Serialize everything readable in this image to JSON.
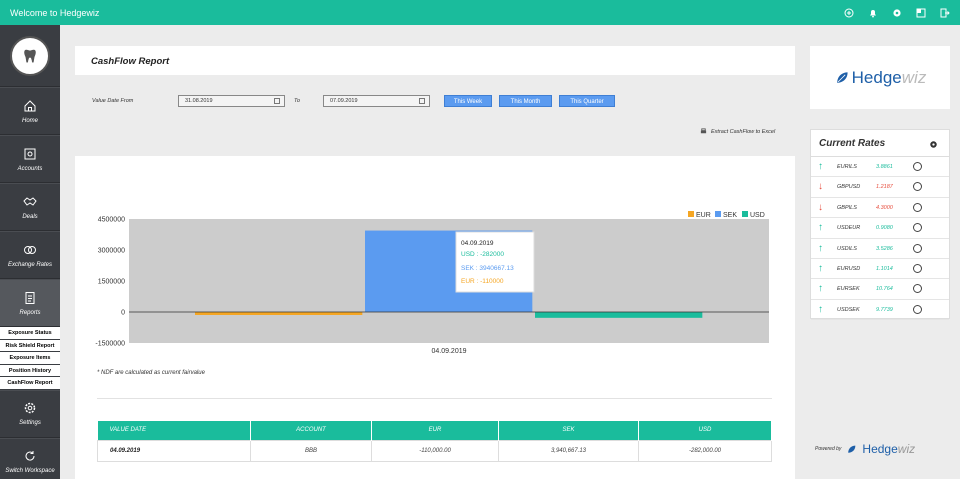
{
  "topbar": {
    "title": "Welcome to Hedgewiz"
  },
  "sidebar": {
    "items": [
      {
        "label": "Home"
      },
      {
        "label": "Accounts"
      },
      {
        "label": "Deals"
      },
      {
        "label": "Exchange Rates"
      },
      {
        "label": "Reports"
      }
    ],
    "subitems": [
      "Exposure Status",
      "Risk Shield Report",
      "Exposure Items",
      "Position History",
      "CashFlow Report"
    ],
    "bottom_items": [
      {
        "label": "Settings"
      },
      {
        "label": "Switch Workspace"
      }
    ]
  },
  "page": {
    "title": "CashFlow Report"
  },
  "filters": {
    "from_label": "Value Date From",
    "from_value": "31.08.2019",
    "to_label": "To",
    "to_value": "07.09.2019",
    "btn_week": "This Week",
    "btn_month": "This Month",
    "btn_quarter": "This Quarter",
    "extract_label": "Extract CashFlow to Excel"
  },
  "chart_data": {
    "type": "bar",
    "categories": [
      "04.09.2019"
    ],
    "series": [
      {
        "name": "EUR",
        "values": [
          -110000
        ],
        "color": "#f5a623"
      },
      {
        "name": "SEK",
        "values": [
          3940667.13
        ],
        "color": "#5b9bf0"
      },
      {
        "name": "USD",
        "values": [
          -282000
        ],
        "color": "#1abc9c"
      }
    ],
    "yticks": [
      "4500000",
      "3000000",
      "1500000",
      "0",
      "-1500000"
    ],
    "ylim": [
      -1500000,
      4500000
    ],
    "legend": "top-right",
    "tooltip": {
      "title": "04.09.2019",
      "usd": "USD : -282000",
      "sek": "SEK : 3940667.13",
      "eur": "EUR : -110000"
    }
  },
  "note": "* NDF are calculated as current fairvalue",
  "table": {
    "headers": [
      "VALUE DATE",
      "ACCOUNT",
      "EUR",
      "SEK",
      "USD"
    ],
    "rows": [
      [
        "04.09.2019",
        "BBB",
        "-110,000.00",
        "3,940,667.13",
        "-282,000.00"
      ]
    ]
  },
  "brand": {
    "name_main": "Hedge",
    "name_sub": "wiz",
    "powered_by": "Powered by"
  },
  "rates": {
    "title": "Current Rates",
    "items": [
      {
        "pair": "EURILS",
        "value": "3.8861",
        "dir": "up"
      },
      {
        "pair": "GBPUSD",
        "value": "1.2187",
        "dir": "down"
      },
      {
        "pair": "GBPILS",
        "value": "4.3000",
        "dir": "down"
      },
      {
        "pair": "USDEUR",
        "value": "0.9080",
        "dir": "up"
      },
      {
        "pair": "USDILS",
        "value": "3.5286",
        "dir": "up"
      },
      {
        "pair": "EURUSD",
        "value": "1.1014",
        "dir": "up"
      },
      {
        "pair": "EURSEK",
        "value": "10.764",
        "dir": "up"
      },
      {
        "pair": "USDSEK",
        "value": "9.7739",
        "dir": "up"
      }
    ]
  },
  "colors": {
    "accent": "#1abc9c",
    "sidebar": "#3a3d42",
    "button": "#5b9bf0",
    "up": "#1abc9c",
    "down": "#e74c3c"
  }
}
